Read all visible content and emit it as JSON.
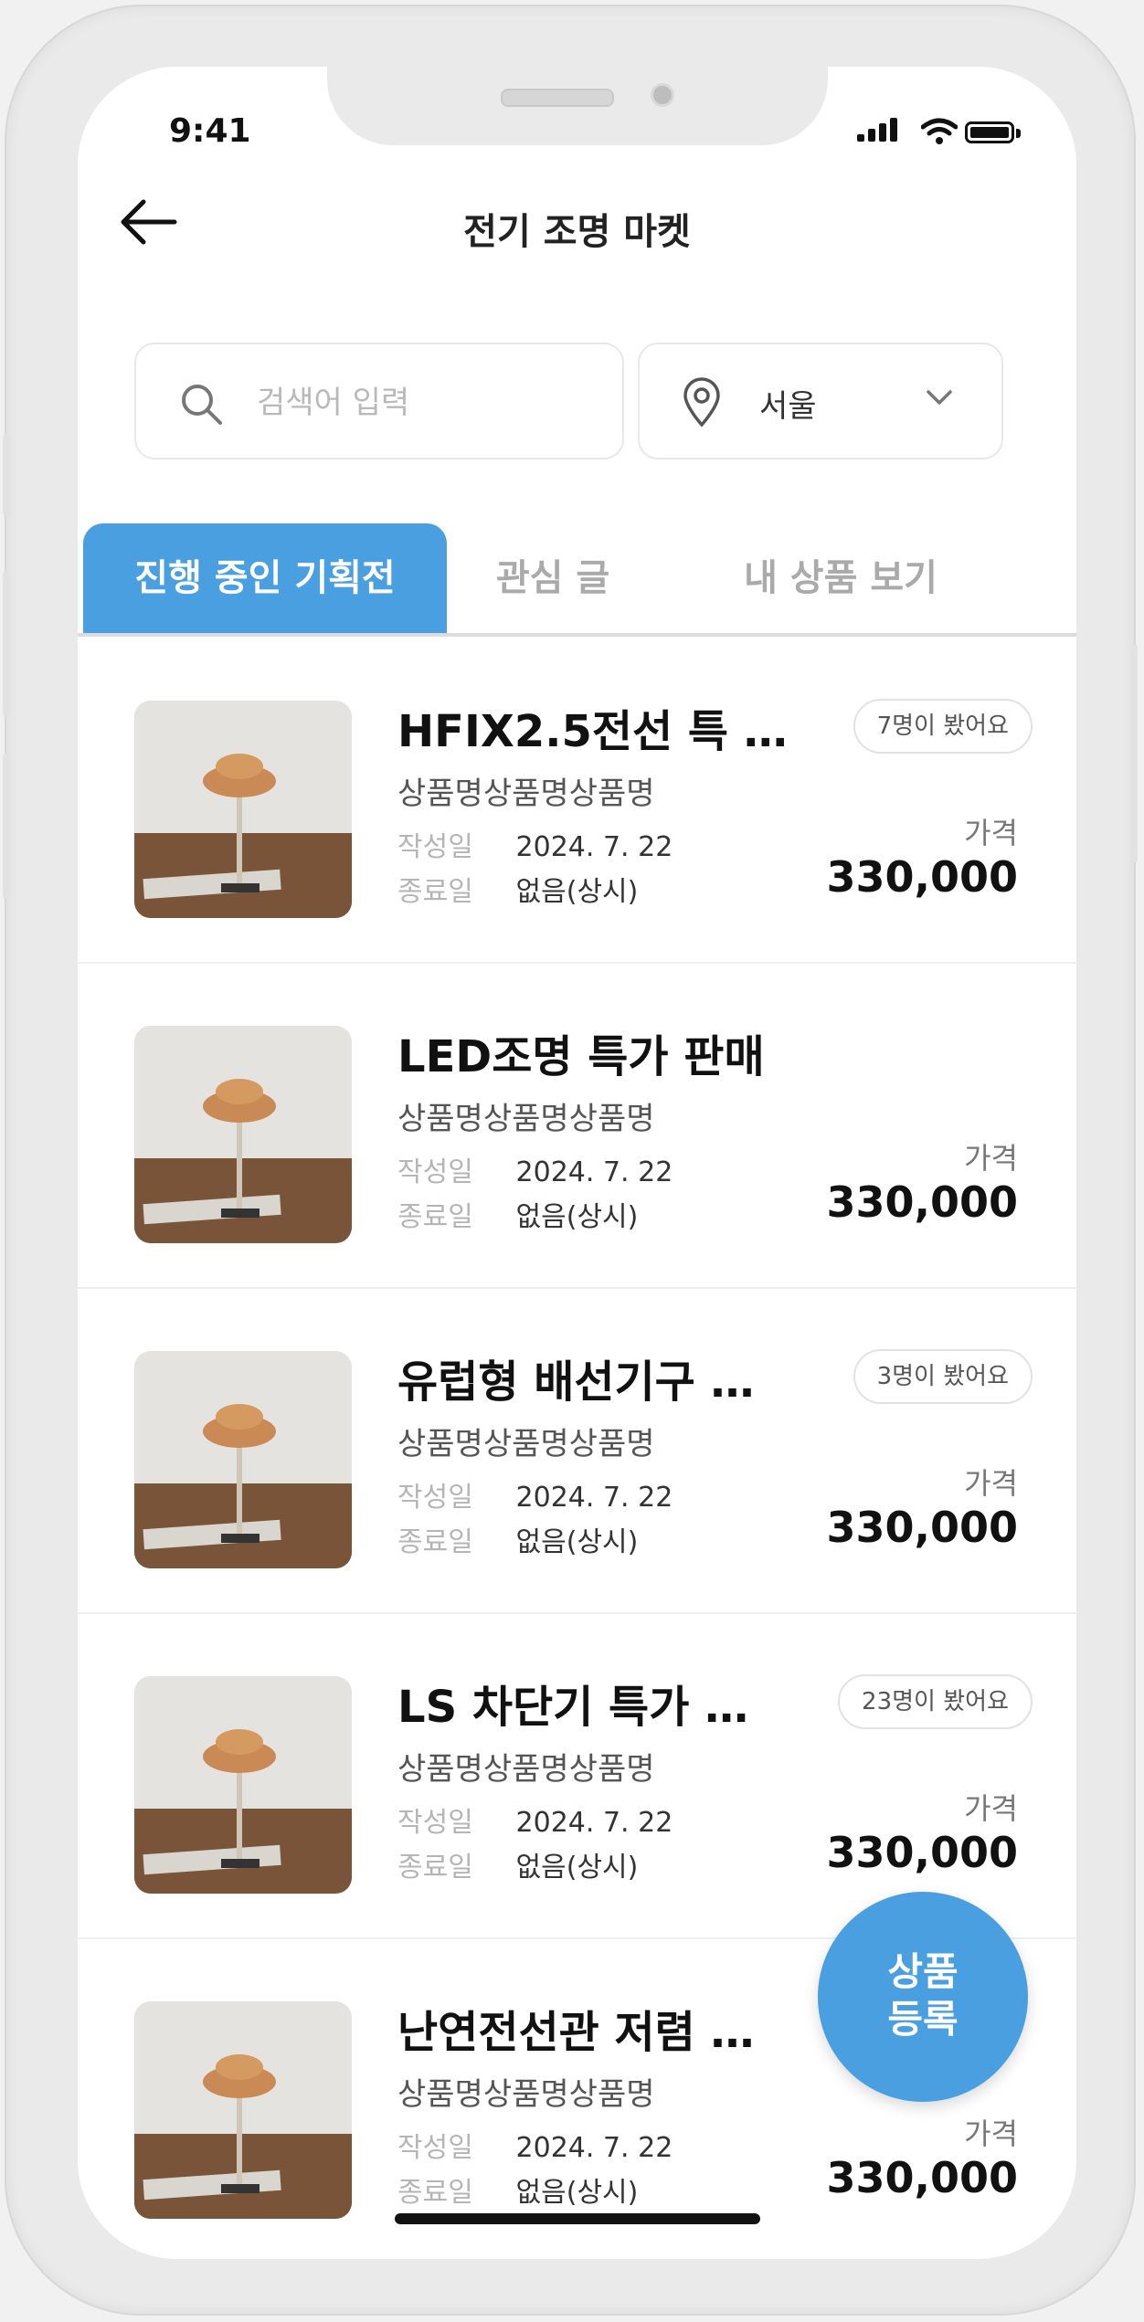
{
  "status_bar": {
    "time": "9:41"
  },
  "header": {
    "title": "전기 조명 마켓",
    "back_icon": "arrow-left-icon"
  },
  "search": {
    "placeholder": "검색어 입력",
    "location": "서울"
  },
  "tabs": [
    {
      "label": "진행 중인 기획전",
      "active": true
    },
    {
      "label": "관심 글",
      "active": false
    },
    {
      "label": "내 상품 보기",
      "active": false
    }
  ],
  "labels": {
    "date_written": "작성일",
    "date_end": "종료일",
    "price": "가격"
  },
  "items": [
    {
      "title": "HFIX2.5전선 특 …",
      "subtitle": "상품명상품명상품명",
      "written": "2024. 7. 22",
      "end": "없음(상시)",
      "price": "330,000",
      "badge": "7명이 봤어요"
    },
    {
      "title": "LED조명 특가 판매",
      "subtitle": "상품명상품명상품명",
      "written": "2024. 7. 22",
      "end": "없음(상시)",
      "price": "330,000",
      "badge": ""
    },
    {
      "title": "유럽형 배선기구 …",
      "subtitle": "상품명상품명상품명",
      "written": "2024. 7. 22",
      "end": "없음(상시)",
      "price": "330,000",
      "badge": "3명이 봤어요"
    },
    {
      "title": "LS 차단기 특가 …",
      "subtitle": "상품명상품명상품명",
      "written": "2024. 7. 22",
      "end": "없음(상시)",
      "price": "330,000",
      "badge": "23명이 봤어요"
    },
    {
      "title": "난연전선관 저렴 …",
      "subtitle": "상품명상품명상품명",
      "written": "2024. 7. 22",
      "end": "없음(상시)",
      "price": "330,000",
      "badge": ""
    }
  ],
  "fab": {
    "line1": "상품",
    "line2": "등록"
  },
  "colors": {
    "accent": "#4a9fe0",
    "text": "#111111",
    "muted": "#b5b5b5"
  }
}
